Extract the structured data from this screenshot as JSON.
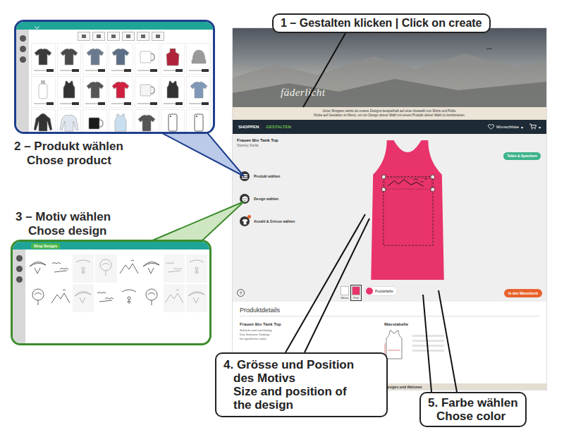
{
  "steps": [
    {
      "lines": [
        "1 – Gestalten klicken | Click on create"
      ]
    },
    {
      "lines": [
        "2 – Produkt wählen",
        "Chose product"
      ]
    },
    {
      "lines": [
        "3 – Motiv wählen",
        "Chose design"
      ]
    },
    {
      "lines": [
        "4. Grösse und Position",
        "des Motivs",
        "Size and position of",
        "the design"
      ]
    },
    {
      "lines": [
        "5. Farbe wählen",
        "Chose color"
      ]
    }
  ],
  "product_picker": {
    "products": [
      {
        "kind": "tshirt",
        "color": "#3a3a3a"
      },
      {
        "kind": "tshirt",
        "color": "#4a4a4a"
      },
      {
        "kind": "tshirt",
        "color": "#6b7a8f"
      },
      {
        "kind": "tshirt",
        "color": "#5d6f86"
      },
      {
        "kind": "mug",
        "color": "#ffffff"
      },
      {
        "kind": "apron",
        "color": "#b0243a"
      },
      {
        "kind": "beanie",
        "color": "#9a9a9a"
      },
      {
        "kind": "bottle",
        "color": "#ffffff"
      },
      {
        "kind": "tank",
        "color": "#333333"
      },
      {
        "kind": "tshirt",
        "color": "#555555"
      },
      {
        "kind": "tshirt",
        "color": "#d0203f"
      },
      {
        "kind": "mug",
        "color": "#f4f4f4"
      },
      {
        "kind": "tank",
        "color": "#333333"
      },
      {
        "kind": "tshirt",
        "color": "#7f98b8"
      },
      {
        "kind": "hoodie",
        "color": "#333333"
      },
      {
        "kind": "longsleeve",
        "color": "#dfe6f0"
      },
      {
        "kind": "mug",
        "color": "#1a1a1a"
      },
      {
        "kind": "tank",
        "color": "#c9dff0"
      },
      {
        "kind": "tshirt",
        "color": "#555555"
      },
      {
        "kind": "phone",
        "color": "#ffffff"
      },
      {
        "kind": "phone",
        "color": "#ffffff"
      }
    ]
  },
  "design_picker": {
    "button": "Shop Designs",
    "designs": [
      {
        "faded": false
      },
      {
        "faded": false
      },
      {
        "faded": true
      },
      {
        "faded": true
      },
      {
        "faded": false
      },
      {
        "faded": false
      },
      {
        "faded": true
      },
      {
        "faded": true
      },
      {
        "faded": false
      },
      {
        "faded": false
      },
      {
        "faded": true
      },
      {
        "faded": false
      },
      {
        "faded": false
      },
      {
        "faded": false
      },
      {
        "faded": true
      },
      {
        "faded": true
      }
    ]
  },
  "shop": {
    "logo": "fäderlicht",
    "intro": [
      "Unter Shoppen siehst du unsere Designs beispielhaft auf einer Auswahl von Shirts und Pullis.",
      "Klicke auf Gestalten im Menü, um ein Design deiner Wahl mit einem Produkt deiner Wahl zu kombinieren."
    ],
    "nav": [
      {
        "label": "SHOPPEN",
        "selected": false
      },
      {
        "label": "GESTALTEN",
        "selected": true
      }
    ],
    "wishlist": "Wunschliste",
    "wishlist_caret": "▾",
    "cart_caret": "▾",
    "product_title": "Frauen Bio Tank Top",
    "brand": "Stanley Stella",
    "options": [
      {
        "label": "Produkt wählen",
        "kind": "product"
      },
      {
        "label": "Design wählen",
        "kind": "design"
      },
      {
        "label": "Anzahl & Grösse wählen",
        "kind": "size"
      }
    ],
    "share_button": "Teilen & Speichern",
    "shirt_color": "#e8336b",
    "swatches": [
      {
        "label": "Weiss",
        "color": "#ffffff",
        "selected": false
      },
      {
        "label": "Pink",
        "color": "#e8336b",
        "selected": true
      }
    ],
    "color_picker": {
      "label": "Produktfarbe",
      "color": "#e8336b"
    },
    "help": "?",
    "cart_button": "In den Warenkorb",
    "details": {
      "heading": "Produktdetails",
      "title": "Frauen Bio Tank Top",
      "description": [
        "Schlicht und nachhaltig:",
        "Das feminine Tanktop",
        "für sportliche Looks"
      ],
      "size_chart": "Masstabelle",
      "footer": "Designs und Aktionen"
    }
  }
}
